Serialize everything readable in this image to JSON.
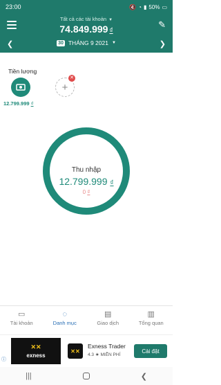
{
  "status_bar": {
    "time": "23:00",
    "battery": "50%"
  },
  "header": {
    "account_selector": "Tất cả các tài khoản",
    "total_amount": "74.849.999",
    "currency": "₫"
  },
  "period": {
    "badge": "30",
    "label": "THÁNG 9 2021"
  },
  "categories": [
    {
      "label": "Tiền lương",
      "amount": "12.799.999",
      "currency": "₫",
      "icon": "money-icon"
    }
  ],
  "summary": {
    "title": "Thu nhập",
    "income": "12.799.999",
    "expense": "0",
    "currency": "₫"
  },
  "nav": {
    "items": [
      {
        "label": "Tài khoản",
        "icon": "wallet-icon"
      },
      {
        "label": "Danh mục",
        "icon": "category-icon"
      },
      {
        "label": "Giao dịch",
        "icon": "transactions-icon"
      },
      {
        "label": "Tổng quan",
        "icon": "overview-icon"
      }
    ],
    "active": "Danh mục"
  },
  "ad": {
    "logo_text": "exness",
    "app_name": "Exness Trader",
    "rating": "4.3",
    "price": "MIỄN PHÍ",
    "cta": "Cài đặt"
  },
  "colors": {
    "primary": "#1f7a6b",
    "accent_green": "#1f8a79",
    "active_nav": "#2a6fb5",
    "expense": "#e98b8b"
  }
}
